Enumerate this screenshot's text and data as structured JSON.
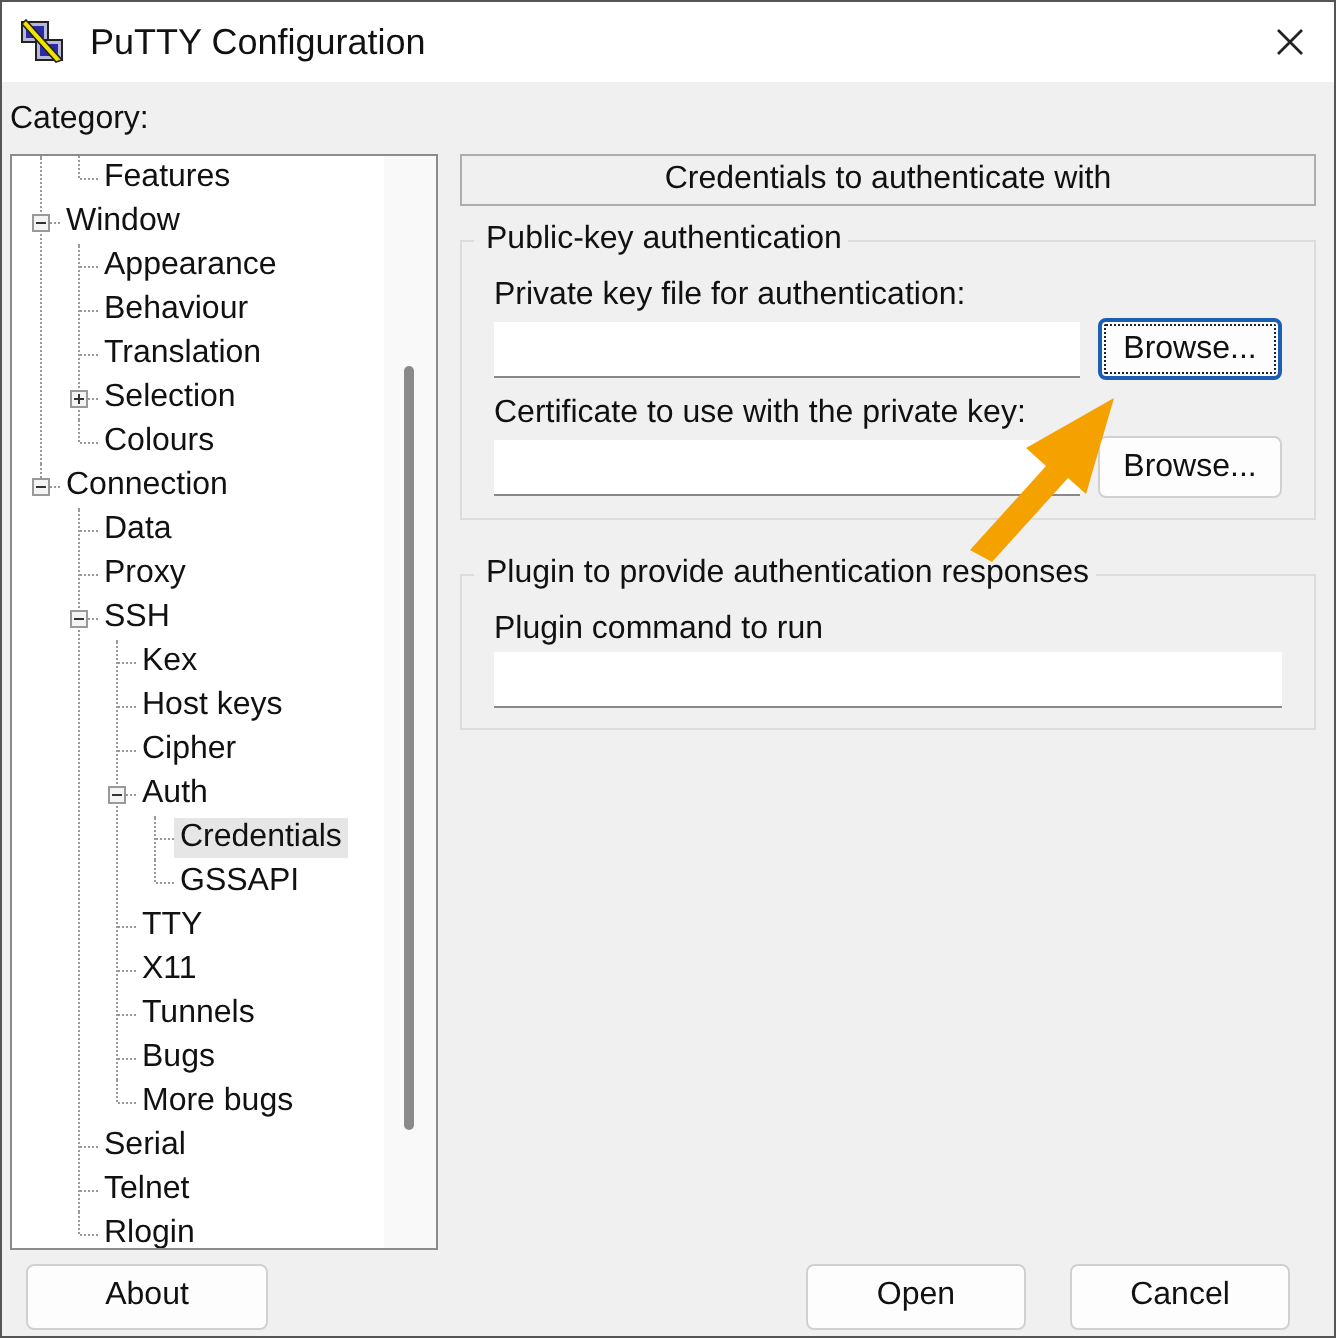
{
  "window": {
    "title": "PuTTY Configuration"
  },
  "category": {
    "label": "Category:",
    "tree": [
      {
        "children": [
          {
            "label": "Features",
            "selected": false
          }
        ]
      },
      {
        "label": "Window",
        "expanded": true,
        "selected": false,
        "children": [
          {
            "label": "Appearance",
            "selected": false
          },
          {
            "label": "Behaviour",
            "selected": false
          },
          {
            "label": "Translation",
            "selected": false
          },
          {
            "label": "Selection",
            "expanded": false,
            "selected": false
          },
          {
            "label": "Colours",
            "selected": false
          }
        ]
      },
      {
        "label": "Connection",
        "expanded": true,
        "selected": false,
        "children": [
          {
            "label": "Data",
            "selected": false
          },
          {
            "label": "Proxy",
            "selected": false
          },
          {
            "label": "SSH",
            "expanded": true,
            "selected": false,
            "children": [
              {
                "label": "Kex",
                "selected": false
              },
              {
                "label": "Host keys",
                "selected": false
              },
              {
                "label": "Cipher",
                "selected": false
              },
              {
                "label": "Auth",
                "expanded": true,
                "selected": false,
                "children": [
                  {
                    "label": "Credentials",
                    "selected": true
                  },
                  {
                    "label": "GSSAPI",
                    "selected": false
                  }
                ]
              },
              {
                "label": "TTY",
                "selected": false
              },
              {
                "label": "X11",
                "selected": false
              },
              {
                "label": "Tunnels",
                "selected": false
              },
              {
                "label": "Bugs",
                "selected": false
              },
              {
                "label": "More bugs",
                "selected": false
              }
            ]
          },
          {
            "label": "Serial",
            "selected": false
          },
          {
            "label": "Telnet",
            "selected": false
          },
          {
            "label": "Rlogin",
            "selected": false
          }
        ]
      }
    ]
  },
  "panel": {
    "header": "Credentials to authenticate with",
    "groups": [
      {
        "title": "Public-key authentication",
        "fields": [
          {
            "label": "Private key file for authentication:",
            "browse": {
              "label": "Browse...",
              "focused": true
            }
          },
          {
            "label": "Certificate to use with the private key:",
            "browse": {
              "label": "Browse...",
              "focused": false
            }
          }
        ]
      },
      {
        "title": "Plugin to provide authentication responses",
        "fields": [
          {
            "label": "Plugin command to run"
          }
        ]
      }
    ]
  },
  "footer": {
    "left": [
      {
        "label": "About"
      }
    ],
    "right": [
      {
        "label": "Open"
      },
      {
        "label": "Cancel"
      }
    ]
  }
}
